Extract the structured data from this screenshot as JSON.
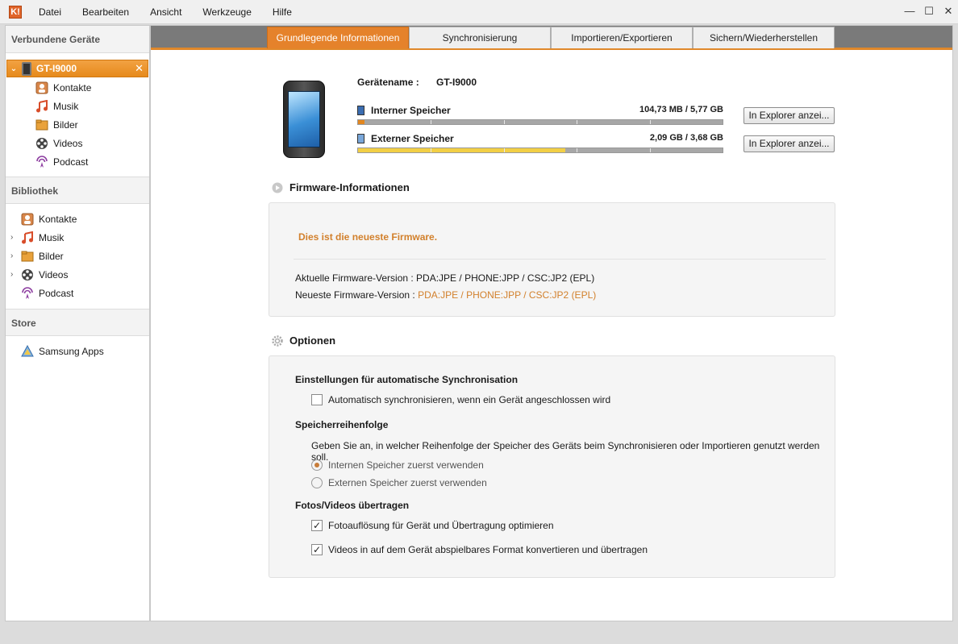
{
  "menubar": {
    "logo_text": "K!",
    "items": [
      "Datei",
      "Bearbeiten",
      "Ansicht",
      "Werkzeuge",
      "Hilfe"
    ]
  },
  "window_controls": {
    "minimize": "—",
    "maximize": "☐",
    "close": "✕"
  },
  "sidebar": {
    "connected_header": "Verbundene Geräte",
    "device": {
      "name": "GT-I9000",
      "close": "✕",
      "chevron": "⌄"
    },
    "device_items": [
      "Kontakte",
      "Musik",
      "Bilder",
      "Videos",
      "Podcast"
    ],
    "library_header": "Bibliothek",
    "library_items": [
      "Kontakte",
      "Musik",
      "Bilder",
      "Videos",
      "Podcast"
    ],
    "store_header": "Store",
    "store_items": [
      "Samsung Apps"
    ]
  },
  "tabs": [
    {
      "label": "Grundlegende Informationen",
      "active": true
    },
    {
      "label": "Synchronisierung",
      "active": false
    },
    {
      "label": "Importieren/Exportieren",
      "active": false
    },
    {
      "label": "Sichern/Wiederherstellen",
      "active": false
    }
  ],
  "device_info": {
    "name_label": "Gerätename",
    "name_sep": ":",
    "name_value": "GT-I9000",
    "internal": {
      "label": "Interner Speicher",
      "size": "104,73 MB / 5,77 GB",
      "used_fraction": 0.018,
      "color": "#e2861f",
      "button": "In Explorer anzei..."
    },
    "external": {
      "label": "Externer Speicher",
      "size": "2,09 GB / 3,68 GB",
      "used_fraction": 0.568,
      "color": "#f2cf45",
      "button": "In Explorer anzei..."
    }
  },
  "firmware": {
    "title": "Firmware-Informationen",
    "message": "Dies ist die neueste Firmware.",
    "current_label": "Aktuelle Firmware-Version : ",
    "current_value": "PDA:JPE / PHONE:JPP / CSC:JP2 (EPL)",
    "latest_label": "Neueste Firmware-Version : ",
    "latest_value": "PDA:JPE / PHONE:JPP / CSC:JP2 (EPL)"
  },
  "options": {
    "title": "Optionen",
    "autosync_header": "Einstellungen für automatische Synchronisation",
    "autosync_label": "Automatisch synchronisieren, wenn ein Gerät angeschlossen wird",
    "autosync_checked": false,
    "storage_order_header": "Speicherreihenfolge",
    "storage_order_desc": "Geben Sie an, in welcher Reihenfolge der Speicher des Geräts beim Synchronisieren oder Importieren genutzt werden soll.",
    "radio_internal": "Internen Speicher zuerst verwenden",
    "radio_external": "Externen Speicher zuerst verwenden",
    "photo_header": "Fotos/Videos übertragen",
    "photo_opt": "Fotoauflösung für Gerät und Übertragung optimieren",
    "video_opt": "Videos in auf dem Gerät abspielbares Format konvertieren und übertragen",
    "checkmark": "✓"
  },
  "colors": {
    "accent": "#e5822b",
    "firmware_text": "#d2802c"
  }
}
